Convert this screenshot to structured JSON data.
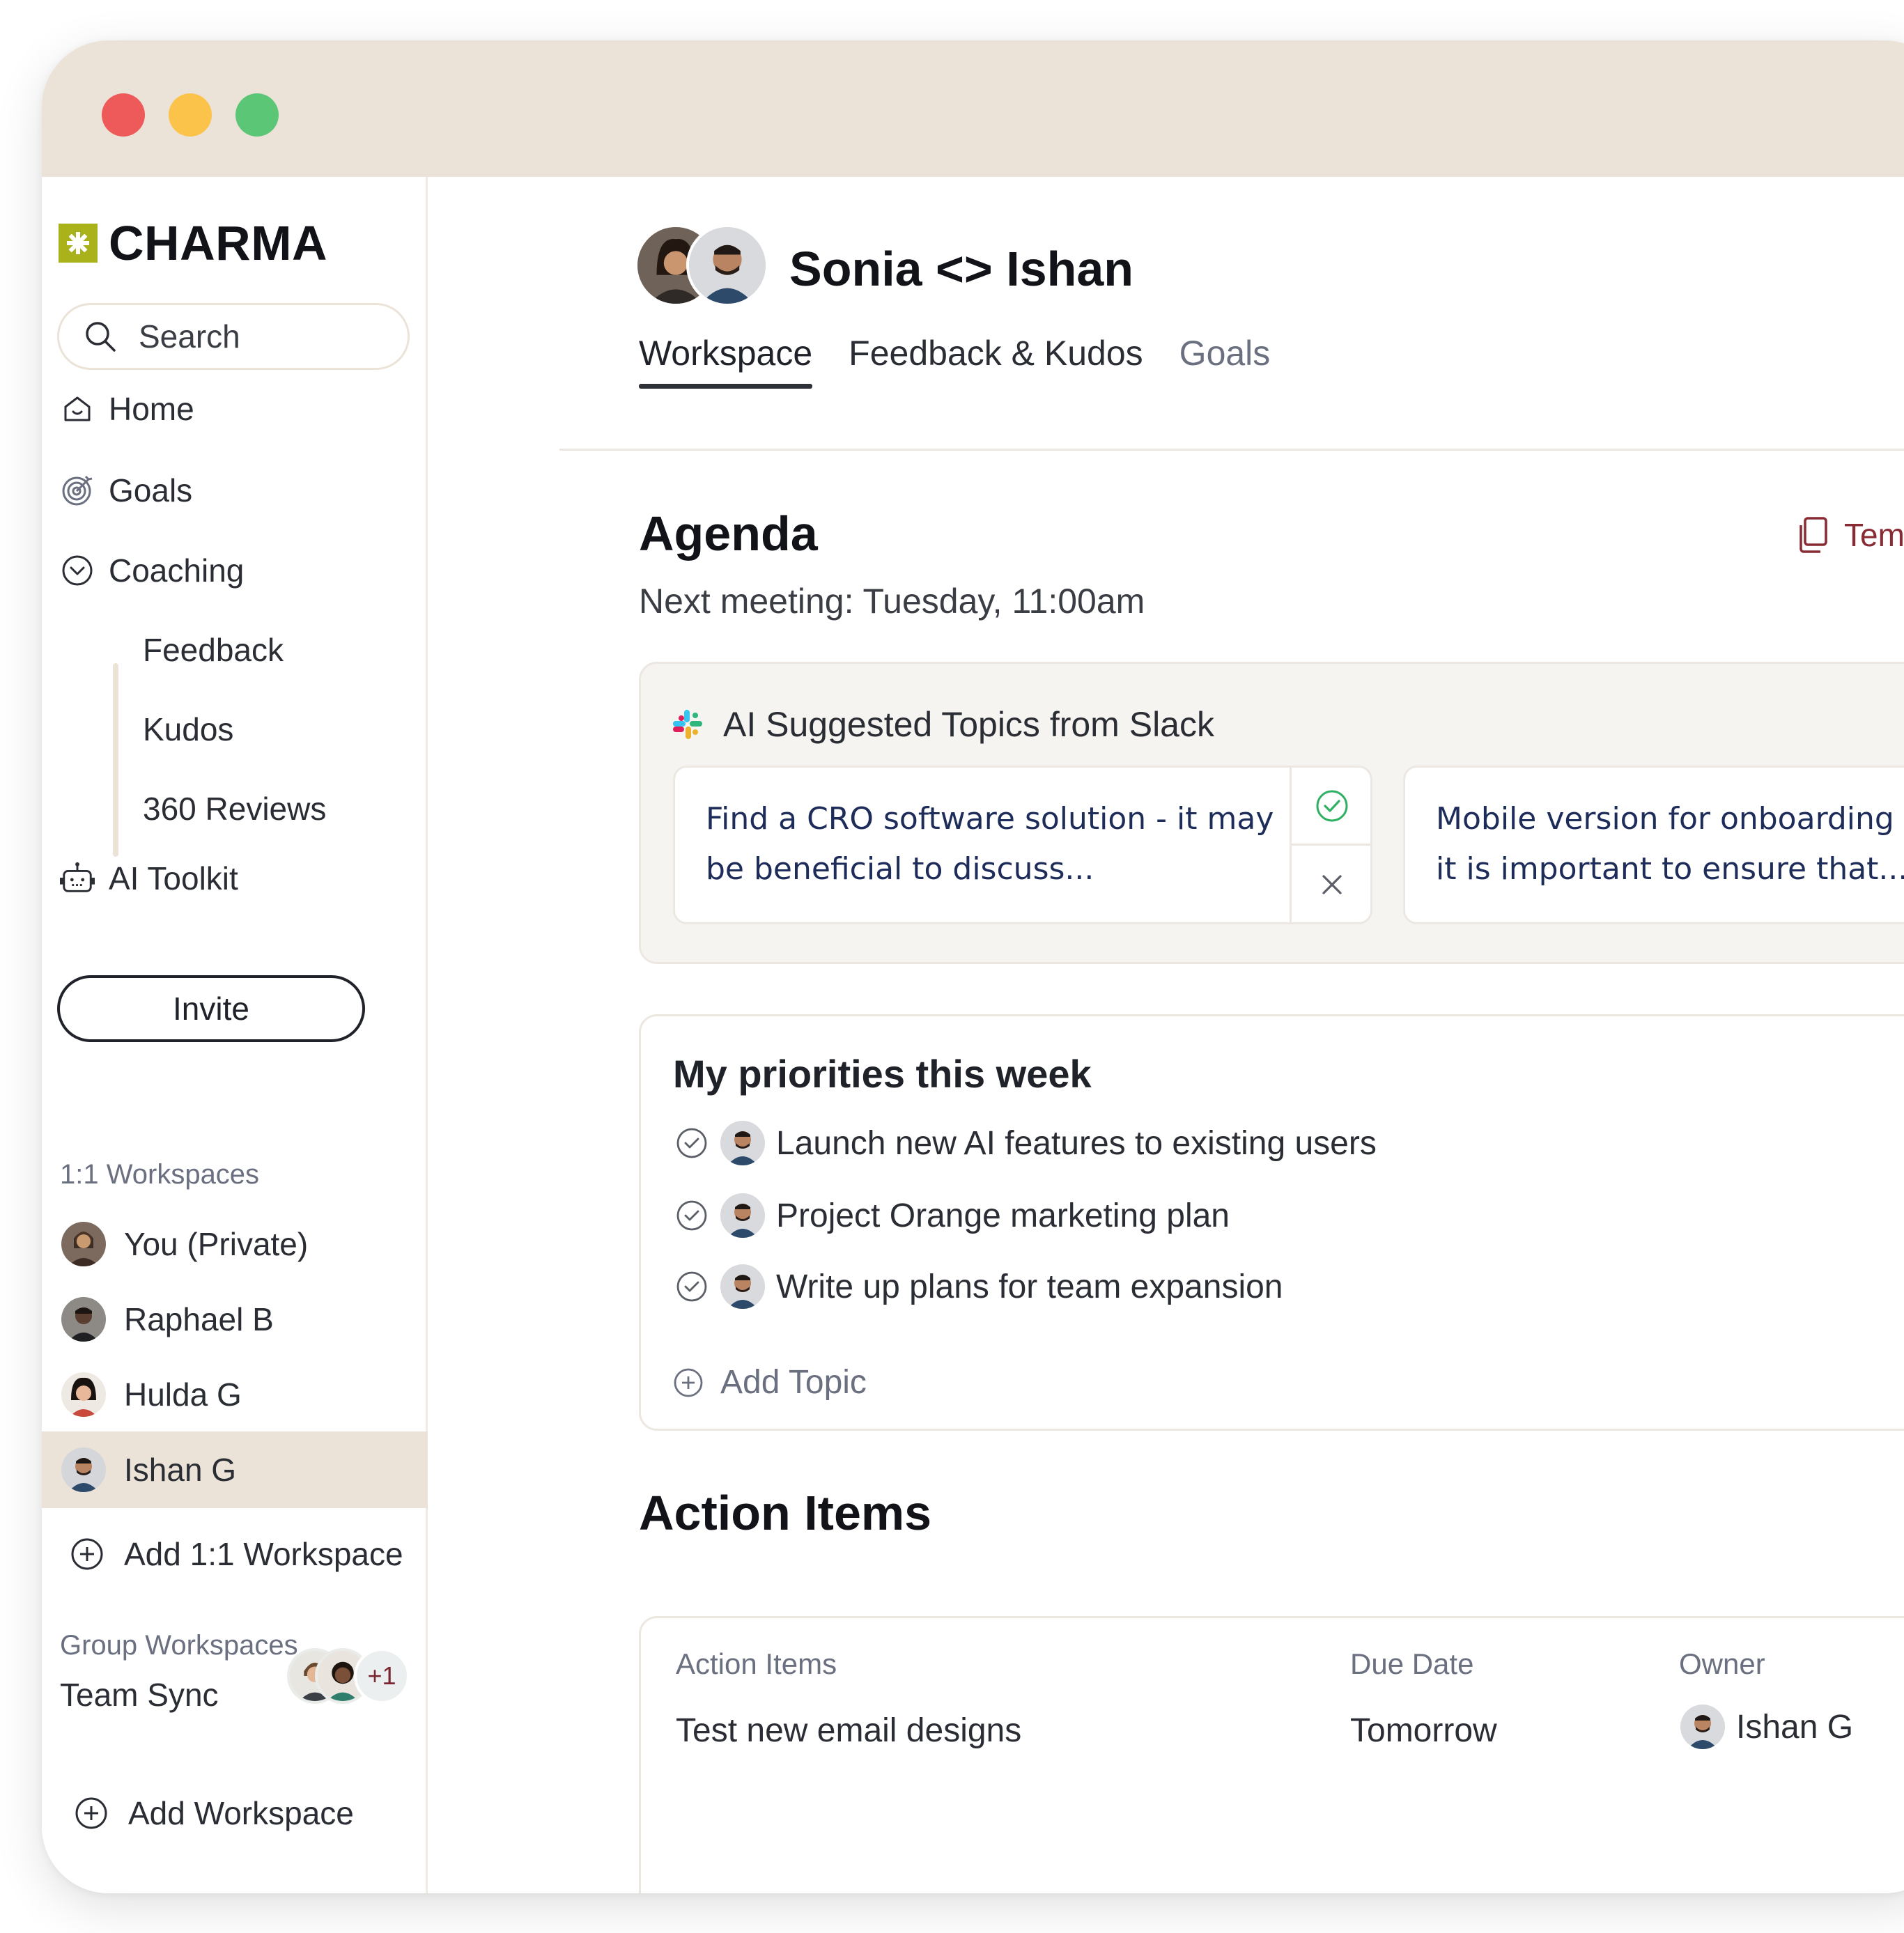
{
  "brand": {
    "name": "CHARMA",
    "accent": "#a9b21a"
  },
  "window": {
    "titlebar_color": "#ece3d8",
    "traffic_lights": [
      "#ee5a5a",
      "#fbc34a",
      "#5cc677"
    ]
  },
  "sidebar": {
    "search": {
      "placeholder": "Search",
      "icon": "search-icon"
    },
    "nav": [
      {
        "label": "Home",
        "icon": "home-icon"
      },
      {
        "label": "Goals",
        "icon": "target-icon"
      },
      {
        "label": "Coaching",
        "icon": "chevron-circle-icon"
      }
    ],
    "coaching_sub": [
      "Feedback",
      "Kudos",
      "360 Reviews"
    ],
    "ai_toolkit": {
      "label": "AI Toolkit",
      "icon": "robot-icon"
    },
    "invite_label": "Invite",
    "one_on_one_label": "1:1 Workspaces",
    "workspaces": [
      {
        "name": "You (Private)",
        "active": false
      },
      {
        "name": "Raphael B",
        "active": false
      },
      {
        "name": "Hulda G",
        "active": false
      },
      {
        "name": "Ishan G",
        "active": true
      }
    ],
    "add_one_on_one": "Add 1:1 Workspace",
    "group_label": "Group Workspaces",
    "groups": [
      {
        "name": "Team Sync",
        "extra_count": "+1"
      }
    ],
    "add_workspace": "Add Workspace"
  },
  "header": {
    "title": "Sonia <> Ishan",
    "tabs": [
      "Workspace",
      "Feedback & Kudos",
      "Goals"
    ],
    "active_tab": "Workspace"
  },
  "agenda": {
    "title": "Agenda",
    "template_label": "Templa",
    "next_meeting": "Next meeting: Tuesday, 11:00am",
    "ai_panel": {
      "title": "AI Suggested Topics from Slack",
      "icon": "slack-icon",
      "topics": [
        {
          "line1": "Find a CRO software solution - it may",
          "line2": "be beneficial to discuss..."
        },
        {
          "line1": "Mobile version for onboarding f",
          "line2": "it is important to ensure that..."
        }
      ]
    },
    "priorities": {
      "title": "My priorities this week",
      "items": [
        "Launch new AI features to existing users",
        "Project Orange marketing plan",
        "Write up plans for team expansion"
      ],
      "add_label": "Add Topic"
    }
  },
  "action_items": {
    "title": "Action Items",
    "columns": [
      "Action Items",
      "Due Date",
      "Owner"
    ],
    "rows": [
      {
        "item": "Test new email designs",
        "due": "Tomorrow",
        "owner": "Ishan G"
      }
    ]
  }
}
